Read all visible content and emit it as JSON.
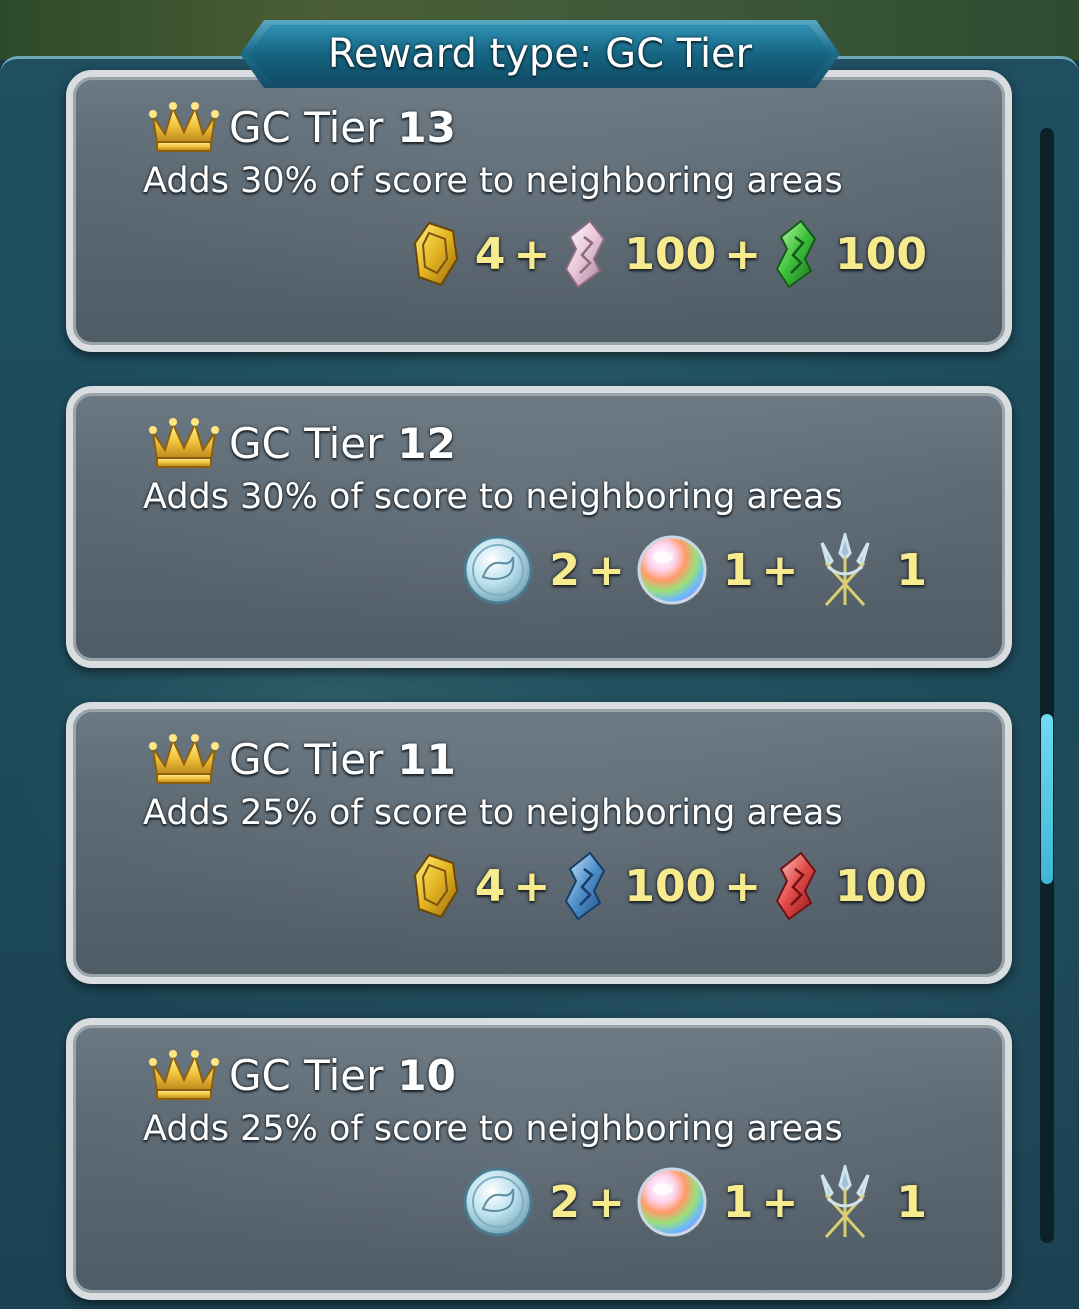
{
  "header": {
    "title": "Reward type: GC Tier"
  },
  "scroll": {
    "position": 0.62
  },
  "tiers": [
    {
      "label": "GC Tier",
      "num": "13",
      "desc": "Adds 30% of score to neighboring areas",
      "rewards": [
        {
          "icon": "gold-badge-icon",
          "count": "4"
        },
        {
          "icon": "pink-shard-icon",
          "count": "100"
        },
        {
          "icon": "green-shard-icon",
          "count": "100"
        }
      ]
    },
    {
      "label": "GC Tier",
      "num": "12",
      "desc": "Adds 30% of score to neighboring areas",
      "rewards": [
        {
          "icon": "silver-coin-icon",
          "count": "2"
        },
        {
          "icon": "rainbow-orb-icon",
          "count": "1"
        },
        {
          "icon": "trident-icon",
          "count": "1"
        }
      ]
    },
    {
      "label": "GC Tier",
      "num": "11",
      "desc": "Adds 25% of score to neighboring areas",
      "rewards": [
        {
          "icon": "gold-badge-icon",
          "count": "4"
        },
        {
          "icon": "blue-shard-icon",
          "count": "100"
        },
        {
          "icon": "red-shard-icon",
          "count": "100"
        }
      ]
    },
    {
      "label": "GC Tier",
      "num": "10",
      "desc": "Adds 25% of score to neighboring areas",
      "rewards": [
        {
          "icon": "silver-coin-icon",
          "count": "2"
        },
        {
          "icon": "rainbow-orb-icon",
          "count": "1"
        },
        {
          "icon": "trident-icon",
          "count": "1"
        }
      ]
    }
  ],
  "colors": {
    "accent": "#2f90b3",
    "count_text": "#f7eb8e",
    "card_border": "#d9dde0"
  }
}
